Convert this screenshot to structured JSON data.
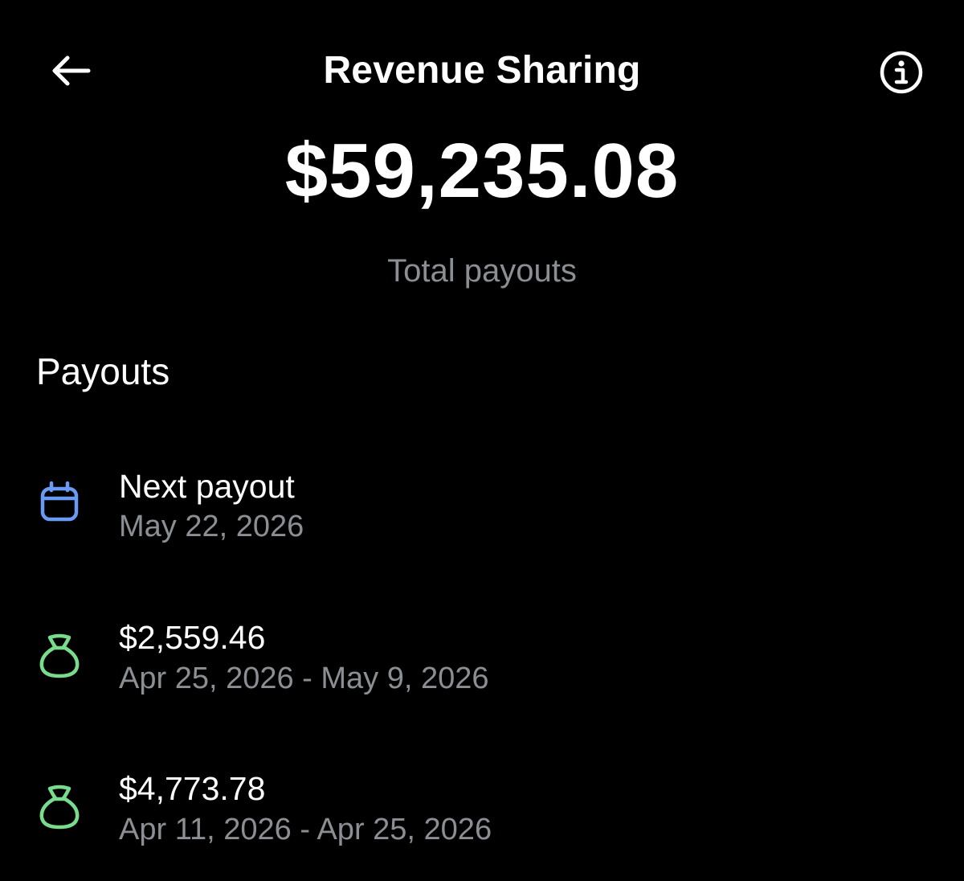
{
  "header": {
    "title": "Revenue Sharing",
    "back_icon": "arrow-left-icon",
    "info_icon": "info-circle-icon"
  },
  "summary": {
    "total_amount": "$59,235.08",
    "total_label": "Total payouts"
  },
  "payouts": {
    "heading": "Payouts",
    "items": [
      {
        "icon": "calendar-icon",
        "icon_color": "#6a9bf4",
        "title": "Next payout",
        "subtitle": "May 22, 2026"
      },
      {
        "icon": "money-bag-icon",
        "icon_color": "#79dc8c",
        "title": "$2,559.46",
        "subtitle": "Apr 25, 2026 - May 9, 2026"
      },
      {
        "icon": "money-bag-icon",
        "icon_color": "#79dc8c",
        "title": "$4,773.78",
        "subtitle": "Apr 11, 2026 - Apr 25, 2026"
      }
    ]
  },
  "colors": {
    "background": "#000000",
    "text_primary": "#ffffff",
    "text_secondary": "#8b8f94"
  }
}
